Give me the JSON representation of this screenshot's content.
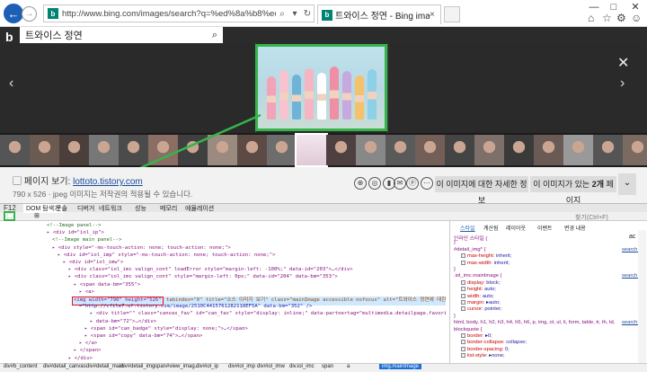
{
  "browser": {
    "address": "http://www.bing.com/images/search?q=%ed%8a%b8%ec%99%80%ec%9d%b4%ec%8a%a4+%ec%a0%95%ec%97%b0&view=d",
    "tab_title": "트와이스 정연 - Bing images",
    "favicon_glyph": "b",
    "back_glyph": "←",
    "forward_glyph": "→",
    "refresh_glyph": "↻",
    "tab_close_glyph": "×",
    "window_controls": [
      "—",
      "□",
      "✕"
    ],
    "right_icons": [
      "⌂",
      "☆",
      "⚙",
      "☺"
    ]
  },
  "bing": {
    "logo_glyph": "b",
    "query": "트와이스 정연",
    "search_icon": "⌕"
  },
  "viewer": {
    "prev_glyph": "‹",
    "next_glyph": "›",
    "close_glyph": "✕",
    "hover_colors": [
      "#f2a3b7",
      "#f7c3d0",
      "#6fb3d9",
      "#f5b5c2",
      "#ffffff",
      "#ef8fa6",
      "#c7a9e0",
      "#f4c26b",
      "#8dd0e8"
    ],
    "thumb_colors": [
      "#555",
      "#6b5a52",
      "#4a3f3a",
      "#777",
      "#4b4b4b",
      "#8a6e64",
      "#3f3f3f",
      "#9a8a80",
      "#5d4a44",
      "#6d6d6d",
      "#e8d9e2",
      "#4e4040",
      "#888",
      "#5a5a5a",
      "#735f58",
      "#444",
      "#7d6f69",
      "#3a3a3a",
      "#6a5a55",
      "#999",
      "#555",
      "#7a6a60"
    ]
  },
  "info": {
    "source_label": "페이지 보기:",
    "source_link": "lottoto.tistory.com",
    "meta": "790 x 526 · jpeg   이미지는 저작권의 적용될 수 있습니다.",
    "more_info_button": "이 이미지에 대한 자세한 정보",
    "pages_button_prefix": "이 이미지가 있는 ",
    "pages_count": "2개",
    "pages_button_suffix": " 페이지",
    "expand_glyph": "⌄",
    "action_icons": [
      "⊕",
      "◎",
      "▮",
      "✉",
      "ⓟ",
      "⋯"
    ]
  },
  "devtools": {
    "f12_label": "F12",
    "tabs": [
      "DOM 탐색기",
      "콘솔",
      "디버거",
      "네트워크",
      "성능",
      "메모리",
      "에뮬레이션"
    ],
    "selected_tab": "DOM 탐색기",
    "find_placeholder": "찾기(Ctrl+F)",
    "pin_glyph": "⊞",
    "style_tabs": [
      "스타일",
      "계산됨",
      "레이아웃",
      "이벤트",
      "변경 내용"
    ],
    "selected_style_tab": "스타일",
    "dom_lines": [
      {
        "indent": 52,
        "html": "<!--Image panel-->",
        "kind": "cm"
      },
      {
        "indent": 52,
        "html": "<div id=\"iol_ip\">",
        "kind": "tg"
      },
      {
        "indent": 58,
        "html": "<!--Image main panel-->",
        "kind": "cm"
      },
      {
        "indent": 58,
        "html": "<div style=\"-ms-touch-action: none; touch-action: none;\">",
        "kind": "tg"
      },
      {
        "indent": 64,
        "html": "<div id=\"iol_imp\" style=\"-ms-touch-action: none; touch-action: none;\">",
        "kind": "tg"
      },
      {
        "indent": 70,
        "html": "<div id=\"iol_imw\">",
        "kind": "tg"
      },
      {
        "indent": 76,
        "html": "<div class=\"iol_imc valign_cont\" loadError style=\"margin-left: -100%;\" data-id=\"203\">…</div>",
        "kind": "tg"
      },
      {
        "indent": 76,
        "html": "<div class=\"iol_imc valign_cont\" style=\"margin-left: 0px;\" data-id=\"204\" data-bm=\"353\">",
        "kind": "tg"
      },
      {
        "indent": 82,
        "html": "<span data-bm=\"355\">",
        "kind": "tg"
      },
      {
        "indent": 88,
        "html": "<a>",
        "kind": "tg"
      }
    ],
    "img_line": {
      "box_text": "<img width=\"790\" height=\"526\"",
      "rest": " tabindex=\"0\" title=\"소스 이미지 보기\" class=\"mainImage accessible nofocus\" alt=\"트와이스 정연에 대한 이미지 결과\" src",
      "rest2": "=\"http://cfile7.uf.tistory.com/image/2510C4415761282118EF5A\" data-bm=\"352\" />"
    },
    "dom_lines_after": [
      {
        "indent": 100,
        "html": "<div title=\"\" class=\"canvas_fav\" id=\"can_fav\" style=\"display: inline;\" data-partnertag=\"multimedia.detailpage.favorite\" tooltip=\"즐겨찾기에 추가\"",
        "kind": "tg"
      },
      {
        "indent": 100,
        "html": "  data-bm=\"72\">…</div>",
        "kind": "tg"
      },
      {
        "indent": 94,
        "html": "<span id=\"can_badge\" style=\"display: none;\">…</span>",
        "kind": "tg"
      },
      {
        "indent": 94,
        "html": "<span id=\"copy\" data-bm=\"74\">…</span>",
        "kind": "tg"
      },
      {
        "indent": 88,
        "html": "</a>",
        "kind": "tg"
      },
      {
        "indent": 82,
        "html": "</span>",
        "kind": "tg"
      },
      {
        "indent": 76,
        "html": "</div>",
        "kind": "tg"
      },
      {
        "indent": 76,
        "html": "<div class=\"iol_imc valign_cont\" loadError style=\"margin-left: 0px;\" data-id=\"205\">…</div>",
        "kind": "tg"
      },
      {
        "indent": 70,
        "html": "</div>",
        "kind": "tg"
      }
    ],
    "styles": [
      {
        "text": "인라인 스타일 {",
        "kind": "sel"
      },
      {
        "text": "}",
        "kind": "sel"
      },
      {
        "text": "#detail_img* {",
        "kind": "sel",
        "link": "search (5)"
      },
      {
        "text": "max-height: inherit;",
        "kind": "pv"
      },
      {
        "text": "max-width: inherit;",
        "kind": "pv"
      },
      {
        "text": "}",
        "kind": "sel"
      },
      {
        "text": ".iol_imc.mainImage {",
        "kind": "sel",
        "link": "search (5)"
      },
      {
        "text": "display: block;",
        "kind": "pv"
      },
      {
        "text": "height: auto;",
        "kind": "pv"
      },
      {
        "text": "width: auto;",
        "kind": "pv"
      },
      {
        "text": "margin: ▸auto;",
        "kind": "pv"
      },
      {
        "text": "cursor: pointer;",
        "kind": "pv"
      },
      {
        "text": "}",
        "kind": "sel"
      },
      {
        "text": "html, body, h1, h2, h3, h4, h5, h6, p, img, ol, ul, li, form, table, tr, th, td,",
        "kind": "sel",
        "link": "search (5)"
      },
      {
        "text": "blockquote {",
        "kind": "sel"
      },
      {
        "text": "border: ▸0;",
        "kind": "pv"
      },
      {
        "text": "border-collapse: collapse;",
        "kind": "pv"
      },
      {
        "text": "border-spacing: 0;",
        "kind": "pv"
      },
      {
        "text": "list-style: ▸none;",
        "kind": "pv"
      }
    ],
    "style_extra": "ac",
    "breadcrumbs": [
      "div#b_content",
      "div#detail_canvas",
      "div#detail_main",
      "div#detail_img",
      "span#view_imag...",
      "div#iol_ip",
      "div#iol_imp",
      "div#iol_imw",
      "div.iol_imc",
      "span",
      "a",
      "img.mainImage"
    ],
    "breadcrumb_selected": "img.mainImage"
  },
  "colors": {
    "accent_green": "#35b44a",
    "highlight_red": "#e11111",
    "bing_teal": "#008373",
    "ie_blue": "#1d5fb5"
  }
}
